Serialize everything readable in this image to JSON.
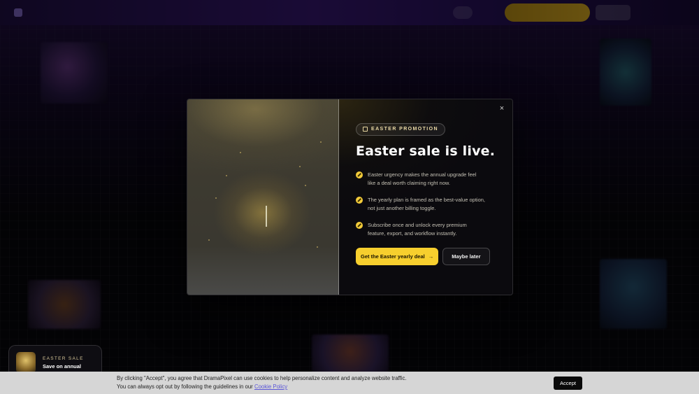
{
  "modal": {
    "badge": "EASTER PROMOTION",
    "headline": "Easter sale is live.",
    "bullets": [
      "Easter urgency makes the annual upgrade feel like a deal worth claiming right now.",
      "The yearly plan is framed as the best-value option, not just another billing toggle.",
      "Subscribe once and unlock every premium feature, export, and workflow instantly."
    ],
    "primary_cta": "Get the Easter yearly deal",
    "primary_arrow": "→",
    "secondary_cta": "Maybe later",
    "close": "×"
  },
  "toast": {
    "label": "EASTER SALE",
    "title": "Save on annual"
  },
  "cookie": {
    "line1": "By clicking \"Accept\", you agree that DramaPixel can use cookies to help personalize content and analyze website traffic.",
    "line2": "You can always opt out by following the guidelines in our ",
    "link": "Cookie Policy",
    "accept": "Accept"
  },
  "colors": {
    "accent": "#f7cf2e",
    "badge_text": "#ead9a6",
    "cookie_bg": "#d6d6d6",
    "link": "#5b56d8"
  },
  "icons": {
    "close": "close-icon",
    "badge": "gift-icon",
    "bullet": "sparkle-icon",
    "cta": "arrow-right-icon"
  }
}
